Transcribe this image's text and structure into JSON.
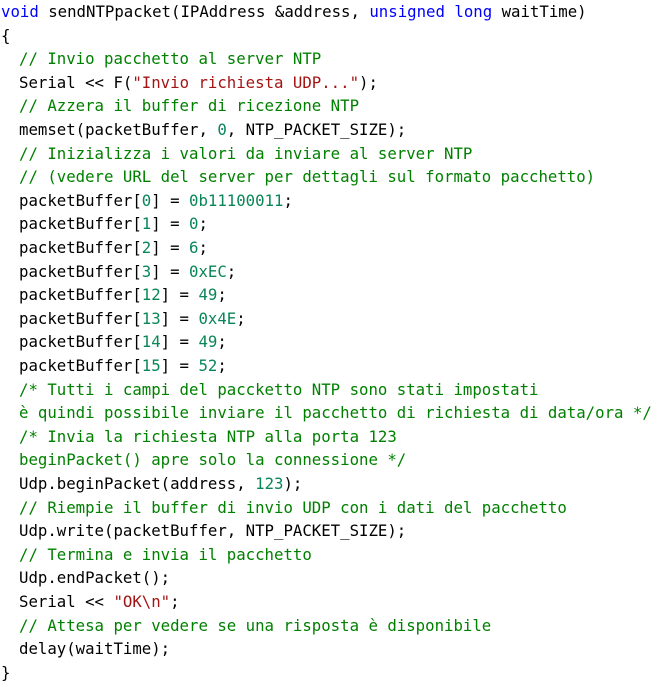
{
  "colors": {
    "keyword": "#0000ff",
    "comment": "#008000",
    "string": "#a31515",
    "number": "#098658",
    "text": "#000000",
    "background": "#ffffff"
  },
  "code": {
    "language": "C++",
    "lines": [
      {
        "indent": 0,
        "tokens": [
          {
            "t": "void",
            "k": "kw"
          },
          {
            "t": " sendNTPpacket(IPAddress &address, ",
            "k": "id"
          },
          {
            "t": "unsigned",
            "k": "kw"
          },
          {
            "t": " ",
            "k": "id"
          },
          {
            "t": "long",
            "k": "kw"
          },
          {
            "t": " waitTime)",
            "k": "id"
          }
        ]
      },
      {
        "indent": 0,
        "tokens": [
          {
            "t": "{",
            "k": "brace"
          }
        ]
      },
      {
        "indent": 1,
        "tokens": [
          {
            "t": "// Invio pacchetto al server NTP",
            "k": "cm"
          }
        ]
      },
      {
        "indent": 1,
        "tokens": [
          {
            "t": "Serial << F(",
            "k": "id"
          },
          {
            "t": "\"Invio richiesta UDP...\"",
            "k": "str"
          },
          {
            "t": ");",
            "k": "id"
          }
        ]
      },
      {
        "indent": 1,
        "tokens": [
          {
            "t": "// Azzera il buffer di ricezione NTP",
            "k": "cm"
          }
        ]
      },
      {
        "indent": 1,
        "tokens": [
          {
            "t": "memset(packetBuffer, ",
            "k": "id"
          },
          {
            "t": "0",
            "k": "num"
          },
          {
            "t": ", NTP_PACKET_SIZE);",
            "k": "id"
          }
        ]
      },
      {
        "indent": 1,
        "tokens": [
          {
            "t": "// Inizializza i valori da inviare al server NTP",
            "k": "cm"
          }
        ]
      },
      {
        "indent": 1,
        "tokens": [
          {
            "t": "// (vedere URL del server per dettagli sul formato pacchetto)",
            "k": "cm"
          }
        ]
      },
      {
        "indent": 1,
        "tokens": [
          {
            "t": "packetBuffer[",
            "k": "id"
          },
          {
            "t": "0",
            "k": "num"
          },
          {
            "t": "] = ",
            "k": "id"
          },
          {
            "t": "0b11100011",
            "k": "num"
          },
          {
            "t": ";",
            "k": "id"
          }
        ]
      },
      {
        "indent": 1,
        "tokens": [
          {
            "t": "packetBuffer[",
            "k": "id"
          },
          {
            "t": "1",
            "k": "num"
          },
          {
            "t": "] = ",
            "k": "id"
          },
          {
            "t": "0",
            "k": "num"
          },
          {
            "t": ";",
            "k": "id"
          }
        ]
      },
      {
        "indent": 1,
        "tokens": [
          {
            "t": "packetBuffer[",
            "k": "id"
          },
          {
            "t": "2",
            "k": "num"
          },
          {
            "t": "] = ",
            "k": "id"
          },
          {
            "t": "6",
            "k": "num"
          },
          {
            "t": ";",
            "k": "id"
          }
        ]
      },
      {
        "indent": 1,
        "tokens": [
          {
            "t": "packetBuffer[",
            "k": "id"
          },
          {
            "t": "3",
            "k": "num"
          },
          {
            "t": "] = ",
            "k": "id"
          },
          {
            "t": "0xEC",
            "k": "num"
          },
          {
            "t": ";",
            "k": "id"
          }
        ]
      },
      {
        "indent": 1,
        "tokens": [
          {
            "t": "packetBuffer[",
            "k": "id"
          },
          {
            "t": "12",
            "k": "num"
          },
          {
            "t": "] = ",
            "k": "id"
          },
          {
            "t": "49",
            "k": "num"
          },
          {
            "t": ";",
            "k": "id"
          }
        ]
      },
      {
        "indent": 1,
        "tokens": [
          {
            "t": "packetBuffer[",
            "k": "id"
          },
          {
            "t": "13",
            "k": "num"
          },
          {
            "t": "] = ",
            "k": "id"
          },
          {
            "t": "0x4E",
            "k": "num"
          },
          {
            "t": ";",
            "k": "id"
          }
        ]
      },
      {
        "indent": 1,
        "tokens": [
          {
            "t": "packetBuffer[",
            "k": "id"
          },
          {
            "t": "14",
            "k": "num"
          },
          {
            "t": "] = ",
            "k": "id"
          },
          {
            "t": "49",
            "k": "num"
          },
          {
            "t": ";",
            "k": "id"
          }
        ]
      },
      {
        "indent": 1,
        "tokens": [
          {
            "t": "packetBuffer[",
            "k": "id"
          },
          {
            "t": "15",
            "k": "num"
          },
          {
            "t": "] = ",
            "k": "id"
          },
          {
            "t": "52",
            "k": "num"
          },
          {
            "t": ";",
            "k": "id"
          }
        ]
      },
      {
        "indent": 1,
        "tokens": [
          {
            "t": "/* Tutti i campi del paccketto NTP sono stati impostati",
            "k": "cm"
          }
        ]
      },
      {
        "indent": 1,
        "tokens": [
          {
            "t": "è quindi possibile inviare il pacchetto di richiesta di data/ora */",
            "k": "cm"
          }
        ]
      },
      {
        "indent": 1,
        "tokens": [
          {
            "t": "/* Invia la richiesta NTP alla porta 123",
            "k": "cm"
          }
        ]
      },
      {
        "indent": 1,
        "tokens": [
          {
            "t": "beginPacket() apre solo la connessione */",
            "k": "cm"
          }
        ]
      },
      {
        "indent": 1,
        "tokens": [
          {
            "t": "Udp.beginPacket(address, ",
            "k": "id"
          },
          {
            "t": "123",
            "k": "num"
          },
          {
            "t": ");",
            "k": "id"
          }
        ]
      },
      {
        "indent": 1,
        "tokens": [
          {
            "t": "// Riempie il buffer di invio UDP con i dati del pacchetto",
            "k": "cm"
          }
        ]
      },
      {
        "indent": 1,
        "tokens": [
          {
            "t": "Udp.write(packetBuffer, NTP_PACKET_SIZE);",
            "k": "id"
          }
        ]
      },
      {
        "indent": 1,
        "tokens": [
          {
            "t": "// Termina e invia il pacchetto",
            "k": "cm"
          }
        ]
      },
      {
        "indent": 1,
        "tokens": [
          {
            "t": "Udp.endPacket();",
            "k": "id"
          }
        ]
      },
      {
        "indent": 1,
        "tokens": [
          {
            "t": "Serial << ",
            "k": "id"
          },
          {
            "t": "\"OK\\n\"",
            "k": "str"
          },
          {
            "t": ";",
            "k": "id"
          }
        ]
      },
      {
        "indent": 1,
        "tokens": [
          {
            "t": "// Attesa per vedere se una risposta è disponibile",
            "k": "cm"
          }
        ]
      },
      {
        "indent": 1,
        "tokens": [
          {
            "t": "delay(waitTime);",
            "k": "id"
          }
        ]
      },
      {
        "indent": 0,
        "tokens": [
          {
            "t": "}",
            "k": "brace"
          }
        ]
      }
    ]
  }
}
